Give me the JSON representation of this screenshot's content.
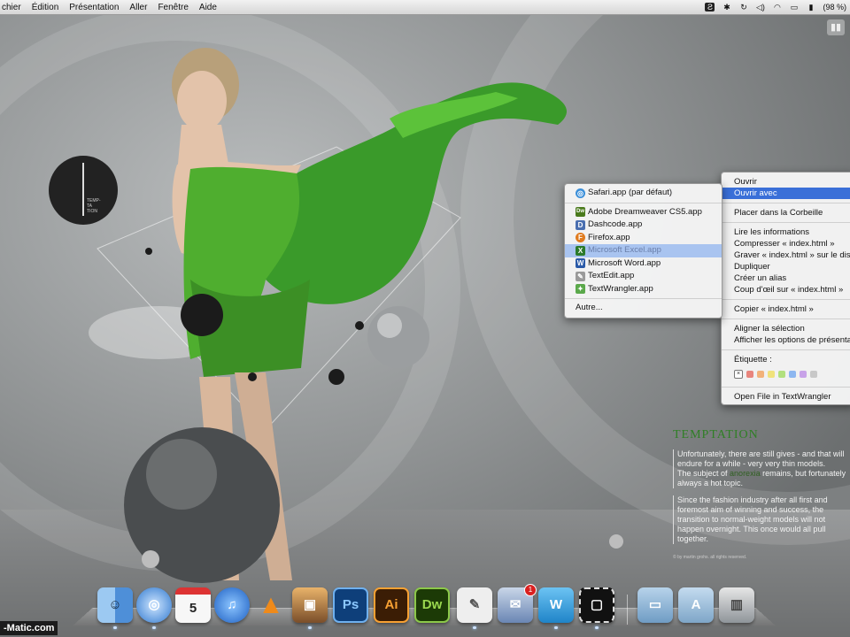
{
  "menubar": {
    "items": [
      "chier",
      "Édition",
      "Présentation",
      "Aller",
      "Fenêtre",
      "Aide"
    ],
    "battery_text": "(98 %)"
  },
  "wallpaper": {
    "circle_text": "TEMP-\nTA\nTION",
    "article": {
      "title": "TEMPTATION",
      "para1_a": "Unfortunately, there are still gives - and that will endure for a while - very very thin models.",
      "para1_b": "The subject of",
      "para1_hl": "anorexia",
      "para1_c": "remains, but fortunately always a hot topic.",
      "para2": "Since the fashion industry after all first and foremost aim of winning and success, the transition to normal-weight models will not happen overnight. This once would all pull together.",
      "credit": "© by martin grohs. all rights reserved."
    }
  },
  "context_menu": {
    "ouvrir": "Ouvrir",
    "ouvrir_avec": "Ouvrir avec",
    "corbeille": "Placer dans la Corbeille",
    "infos": "Lire les informations",
    "compresser": "Compresser « index.html »",
    "graver": "Graver « index.html » sur le disque...",
    "dupliquer": "Dupliquer",
    "alias": "Créer un alias",
    "coup_oeil": "Coup d'œil sur « index.html »",
    "copier": "Copier « index.html »",
    "aligner": "Aligner la sélection",
    "options": "Afficher les options de présentation",
    "etiquette": "Étiquette :",
    "open_tw": "Open File in TextWrangler",
    "label_colors": [
      "#e8857d",
      "#f2b27a",
      "#f0e27c",
      "#b2e07e",
      "#8db7f0",
      "#c8a2e8",
      "#c8c8c8"
    ]
  },
  "submenu": {
    "items": [
      {
        "label": "Safari.app (par défaut)",
        "icon": "safari-icon",
        "color": "#3b8fd9",
        "glyph": "◎"
      },
      {
        "label": "Adobe Dreamweaver CS5.app",
        "icon": "dreamweaver-icon",
        "color": "#4a7a1c",
        "glyph": "Dw"
      },
      {
        "label": "Dashcode.app",
        "icon": "dashcode-icon",
        "color": "#4a6fb0",
        "glyph": "D"
      },
      {
        "label": "Firefox.app",
        "icon": "firefox-icon",
        "color": "#e07b1f",
        "glyph": "F"
      },
      {
        "label": "Microsoft Excel.app",
        "icon": "excel-icon",
        "color": "#2b7a2b",
        "glyph": "X"
      },
      {
        "label": "Microsoft Word.app",
        "icon": "word-icon",
        "color": "#2a5aa8",
        "glyph": "W"
      },
      {
        "label": "TextEdit.app",
        "icon": "textedit-icon",
        "color": "#9a9a9a",
        "glyph": "✎"
      },
      {
        "label": "TextWrangler.app",
        "icon": "textwrangler-icon",
        "color": "#5aa84a",
        "glyph": "✦"
      }
    ],
    "other": "Autre..."
  },
  "dock": {
    "apps": [
      {
        "name": "finder-icon",
        "glyph": "☺",
        "bg": "#5ea1e6"
      },
      {
        "name": "safari-icon",
        "glyph": "◎",
        "bg": "#3d86d6"
      },
      {
        "name": "ical-icon",
        "glyph": "5",
        "bg": "#f4f4f4"
      },
      {
        "name": "itunes-icon",
        "glyph": "♫",
        "bg": "#2c6fd1"
      },
      {
        "name": "vlc-icon",
        "glyph": "▲",
        "bg": "#e8862a"
      },
      {
        "name": "iphoto-icon",
        "glyph": "▣",
        "bg": "#6b7a8a"
      },
      {
        "name": "photoshop-icon",
        "glyph": "Ps",
        "bg": "#1d5fa8"
      },
      {
        "name": "illustrator-icon",
        "glyph": "Ai",
        "bg": "#e9831c"
      },
      {
        "name": "dreamweaver-icon",
        "glyph": "Dw",
        "bg": "#4e8a1d"
      },
      {
        "name": "script-editor-icon",
        "glyph": "✎",
        "bg": "#dcdcdc"
      },
      {
        "name": "mail-icon",
        "glyph": "✉",
        "bg": "#5678a8"
      },
      {
        "name": "word-icon",
        "glyph": "W",
        "bg": "#2f9ad6"
      },
      {
        "name": "screenshot-icon",
        "glyph": "▢",
        "bg": "#222222"
      },
      {
        "name": "applications-folder-icon",
        "glyph": "▭",
        "bg": "#7fa9cc"
      },
      {
        "name": "downloads-folder-icon",
        "glyph": "A",
        "bg": "#8fb3d4"
      },
      {
        "name": "trash-icon",
        "glyph": "▥",
        "bg": "#9aa0a5"
      }
    ],
    "mail_badge": "1"
  },
  "watermark": "-Matic.com"
}
